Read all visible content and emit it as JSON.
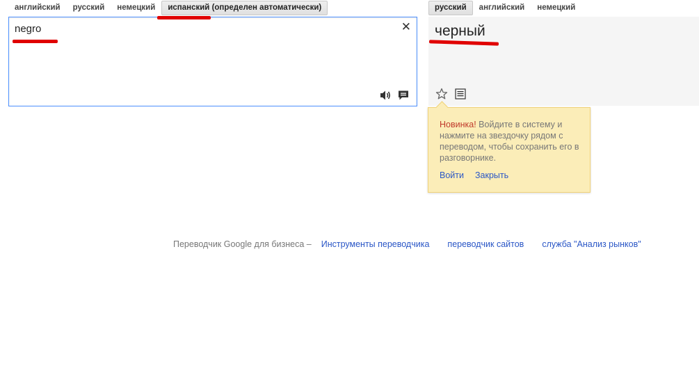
{
  "source_langs": [
    "английский",
    "русский",
    "немецкий",
    "испанский (определен автоматически)"
  ],
  "target_langs": [
    "русский",
    "английский",
    "немецкий"
  ],
  "source": {
    "text": "negro",
    "clear_label": "✕"
  },
  "target": {
    "text": "черный"
  },
  "bubble": {
    "new_label": "Новинка!",
    "message": "Войдите в систему и нажмите на звездочку рядом с переводом, чтобы сохранить его в разговорнике.",
    "login_label": "Войти",
    "close_label": "Закрыть"
  },
  "footer": {
    "prefix": "Переводчик Google для бизнеса –",
    "links": [
      "Инструменты переводчика",
      "переводчик сайтов",
      "служба \"Анализ рынков\""
    ]
  },
  "colors": {
    "accent_link": "#2a56c6",
    "annotation_red": "#e00000",
    "bubble_bg": "#fbedb8",
    "input_border": "#4d90fe"
  },
  "icons": [
    "close-icon",
    "speaker-icon",
    "feedback-icon",
    "star-icon",
    "list-icon"
  ]
}
